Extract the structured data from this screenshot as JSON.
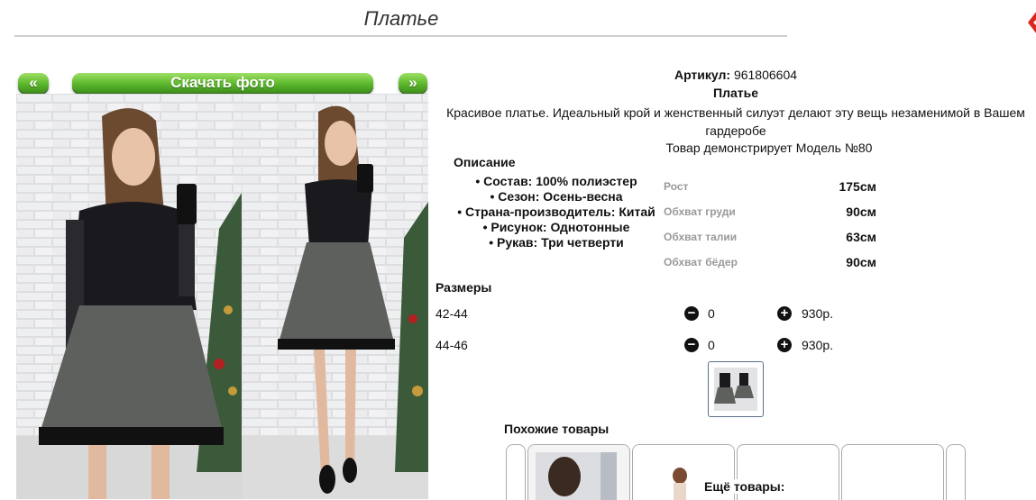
{
  "page": {
    "title": "Платье"
  },
  "gallery": {
    "prev_label": "«",
    "download_label": "Скачать фото",
    "next_label": "»"
  },
  "product": {
    "sku_label": "Артикул:",
    "sku_value": "961806604",
    "name": "Платье",
    "description": "Красивое платье. Идеальный крой и женственный силуэт делают эту вещь незаменимой в Вашем гардеробе",
    "model_line": "Товар демонстрирует Модель №80"
  },
  "details": {
    "heading": "Описание",
    "items": [
      "Состав: 100% полиэстер",
      "Сезон: Осень-весна",
      "Страна-производитель: Китай",
      "Рисунок: Однотонные",
      "Рукав: Три четверти"
    ]
  },
  "measurements": [
    {
      "label": "Рост",
      "value": "175см"
    },
    {
      "label": "Обхват груди",
      "value": "90см"
    },
    {
      "label": "Обхват талии",
      "value": "63см"
    },
    {
      "label": "Обхват бёдер",
      "value": "90см"
    }
  ],
  "sizes": {
    "heading": "Размеры",
    "rows": [
      {
        "size": "42-44",
        "qty": "0",
        "price": "930р."
      },
      {
        "size": "44-46",
        "qty": "0",
        "price": "930р."
      }
    ]
  },
  "similar": {
    "heading": "Похожие товары",
    "more_label": "Ещё товары:"
  },
  "colors": {
    "accent_green": "#5cb82c",
    "brand_red": "#d9261c",
    "muted": "#999999"
  }
}
